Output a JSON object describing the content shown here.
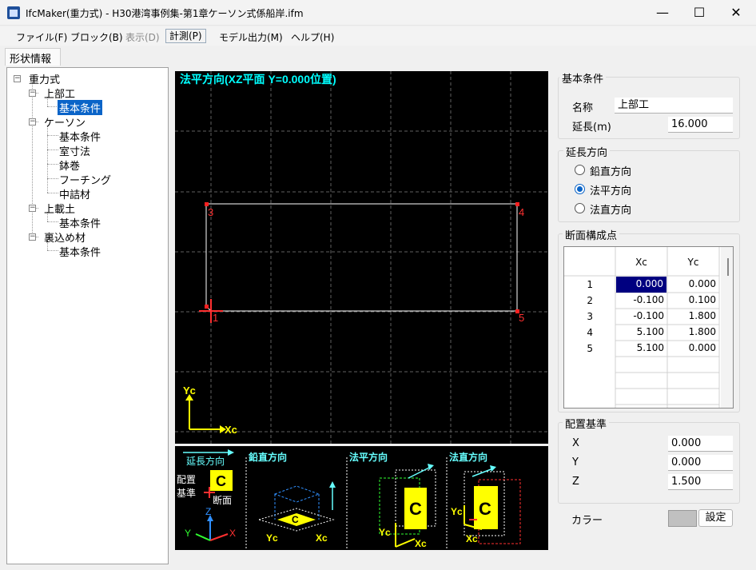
{
  "window": {
    "title": "IfcMaker(重力式) - H30港湾事例集-第1章ケーソン式係船岸.ifm",
    "controls": {
      "minimize": "—",
      "maximize": "☐",
      "close": "✕"
    }
  },
  "menu": [
    {
      "label": "ファイル(F)",
      "state": "normal"
    },
    {
      "label": "ブロック(B)",
      "state": "normal"
    },
    {
      "label": "表示(D)",
      "state": "disabled"
    },
    {
      "label": "計測(P)",
      "state": "framed"
    },
    {
      "label": "モデル出力(M)",
      "state": "normal"
    },
    {
      "label": "ヘルプ(H)",
      "state": "normal"
    }
  ],
  "tab": {
    "label": "形状情報"
  },
  "tree": {
    "toggle": "−",
    "items": [
      {
        "label": "重力式"
      },
      {
        "label": "上部工"
      },
      {
        "label": "基本条件",
        "selected": true
      },
      {
        "label": "ケーソン"
      },
      {
        "label": "基本条件"
      },
      {
        "label": "室寸法"
      },
      {
        "label": "鉢巻"
      },
      {
        "label": "フーチング"
      },
      {
        "label": "中詰材"
      },
      {
        "label": "上載土"
      },
      {
        "label": "基本条件"
      },
      {
        "label": "裏込め材"
      },
      {
        "label": "基本条件"
      }
    ]
  },
  "canvas": {
    "title": "法平方向(XZ平面 Y=0.000位置)",
    "title_color": "#00ffff",
    "point_labels": [
      "1",
      "3",
      "4",
      "5"
    ],
    "axis_labels": {
      "y": "Yc",
      "x": "Xc"
    }
  },
  "legend": {
    "extend_direction": "延長方向",
    "placement_line1": "配置",
    "placement_line2": "基準",
    "section": "断面",
    "c_glyph": "C",
    "views": [
      "鉛直方向",
      "法平方向",
      "法直方向"
    ],
    "axes": {
      "z": "Z",
      "y": "Y",
      "x": "X",
      "yc": "Yc",
      "xc": "Xc"
    }
  },
  "basic_conditions": {
    "group_label": "基本条件",
    "name_label": "名称",
    "name_value": "上部工",
    "length_label": "延長(m)",
    "length_value": "16.000"
  },
  "extension_direction": {
    "group_label": "延長方向",
    "options": [
      {
        "label": "鉛直方向",
        "checked": false
      },
      {
        "label": "法平方向",
        "checked": true
      },
      {
        "label": "法直方向",
        "checked": false
      }
    ]
  },
  "section_points": {
    "group_label": "断面構成点",
    "headers": [
      "Xc",
      "Yc"
    ],
    "rows": [
      {
        "no": "1",
        "xc": "0.000",
        "yc": "0.000"
      },
      {
        "no": "2",
        "xc": "-0.100",
        "yc": "0.100"
      },
      {
        "no": "3",
        "xc": "-0.100",
        "yc": "1.800"
      },
      {
        "no": "4",
        "xc": "5.100",
        "yc": "1.800"
      },
      {
        "no": "5",
        "xc": "5.100",
        "yc": "0.000"
      }
    ]
  },
  "placement": {
    "group_label": "配置基準",
    "x_label": "X",
    "x_value": "0.000",
    "y_label": "Y",
    "y_value": "0.000",
    "z_label": "Z",
    "z_value": "1.500"
  },
  "color": {
    "label": "カラー",
    "swatch": "#c0c0c0",
    "button": "設定"
  }
}
